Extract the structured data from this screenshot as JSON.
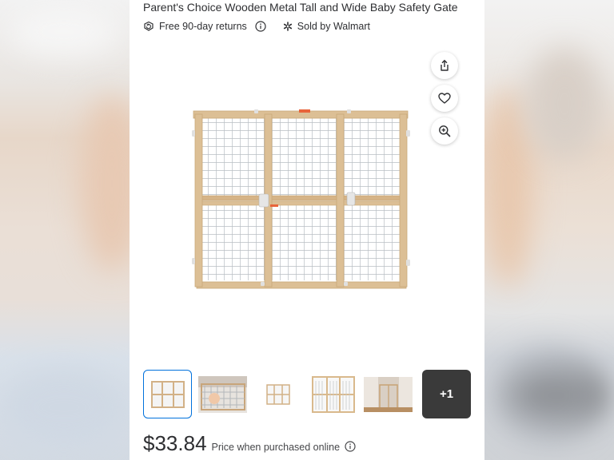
{
  "product": {
    "title": "Parent's Choice Wooden Metal Tall and Wide Baby Safety Gate",
    "returns_label": "Free 90-day returns",
    "sold_by_label": "Sold by Walmart",
    "image_alt_icon": "baby-gate-image"
  },
  "actions": {
    "share_icon": "share-icon",
    "favorite_icon": "heart-icon",
    "zoom_icon": "zoom-in-icon"
  },
  "thumbnails": {
    "count_visible": 5,
    "more_label": "+1"
  },
  "pricing": {
    "price": "$33.84",
    "note": "Price when purchased online"
  },
  "colors": {
    "accent": "#0071dc",
    "text": "#2e2f32",
    "wood": "#d9b98c"
  }
}
